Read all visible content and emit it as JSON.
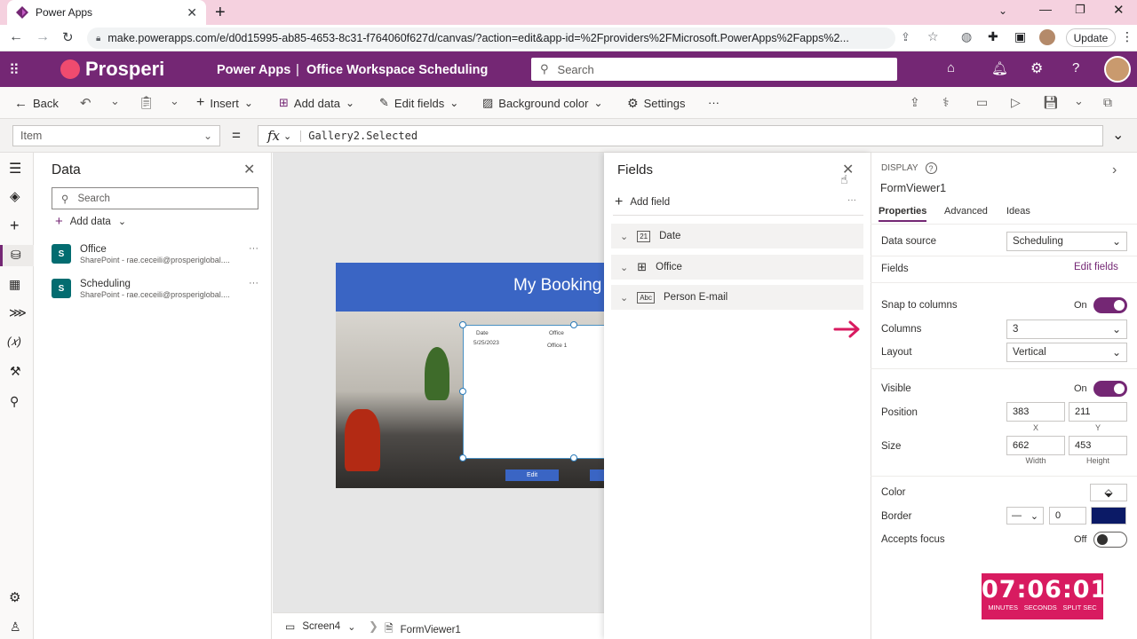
{
  "browser": {
    "tab_title": "Power Apps",
    "url": "make.powerapps.com/e/d0d15995-ab85-4653-8c31-f764060f627d/canvas/?action=edit&app-id=%2Fproviders%2FMicrosoft.PowerApps%2Fapps%2...",
    "update_label": "Update"
  },
  "header": {
    "brand": "Prosperi",
    "app_name": "Power Apps",
    "separator": "|",
    "project": "Office Workspace Scheduling",
    "search_placeholder": "Search"
  },
  "toolbar": {
    "back": "Back",
    "insert": "Insert",
    "add_data": "Add data",
    "edit_fields": "Edit fields",
    "background_color": "Background color",
    "settings": "Settings",
    "more": "···"
  },
  "formula": {
    "property": "Item",
    "equals": "=",
    "fx": "fx",
    "expression": "Gallery2.Selected"
  },
  "data_pane": {
    "title": "Data",
    "search_placeholder": "Search",
    "add_data": "Add data",
    "sources": [
      {
        "name": "Office",
        "sub": "SharePoint - rae.ceceili@prosperiglobal...."
      },
      {
        "name": "Scheduling",
        "sub": "SharePoint - rae.ceceili@prosperiglobal...."
      }
    ]
  },
  "canvas": {
    "banner_title": "My Booking",
    "form_col1_label": "Date",
    "form_col1_value": "5/25/2023",
    "form_col2_label": "Office",
    "form_col2_value": "Office 1",
    "edit_button": "Edit",
    "screen_name": "Screen4",
    "control_name": "FormViewer1"
  },
  "fields_pane": {
    "title": "Fields",
    "add_field": "Add field",
    "more": "···",
    "fields": [
      {
        "name": "Date",
        "icon": "calendar-icon",
        "glyph": "21"
      },
      {
        "name": "Office",
        "icon": "table-icon",
        "glyph": ""
      },
      {
        "name": "Person E-mail",
        "icon": "text-icon",
        "glyph": "Abc"
      }
    ]
  },
  "properties": {
    "section": "DISPLAY",
    "control": "FormViewer1",
    "tabs": [
      "Properties",
      "Advanced",
      "Ideas"
    ],
    "data_source_label": "Data source",
    "data_source_value": "Scheduling",
    "fields_label": "Fields",
    "edit_fields_link": "Edit fields",
    "snap_label": "Snap to columns",
    "snap_value": "On",
    "columns_label": "Columns",
    "columns_value": "3",
    "layout_label": "Layout",
    "layout_value": "Vertical",
    "visible_label": "Visible",
    "visible_value": "On",
    "position_label": "Position",
    "position_x": "383",
    "position_y": "211",
    "x_label": "X",
    "y_label": "Y",
    "size_label": "Size",
    "width": "662",
    "height": "453",
    "width_label": "Width",
    "height_label": "Height",
    "color_label": "Color",
    "border_label": "Border",
    "border_width": "0",
    "border_color": "#0b1a66",
    "accepts_focus_label": "Accepts focus",
    "accepts_focus_value": "Off"
  },
  "timer": {
    "time": "07:06:01",
    "labels": [
      "MINUTES",
      "SECONDS",
      "SPLIT SEC"
    ]
  },
  "colors": {
    "app_bar": "#742774",
    "accent": "#742774",
    "banner": "#3a65c4",
    "arrow": "#d81b60",
    "timer_bg": "#d81b60"
  }
}
